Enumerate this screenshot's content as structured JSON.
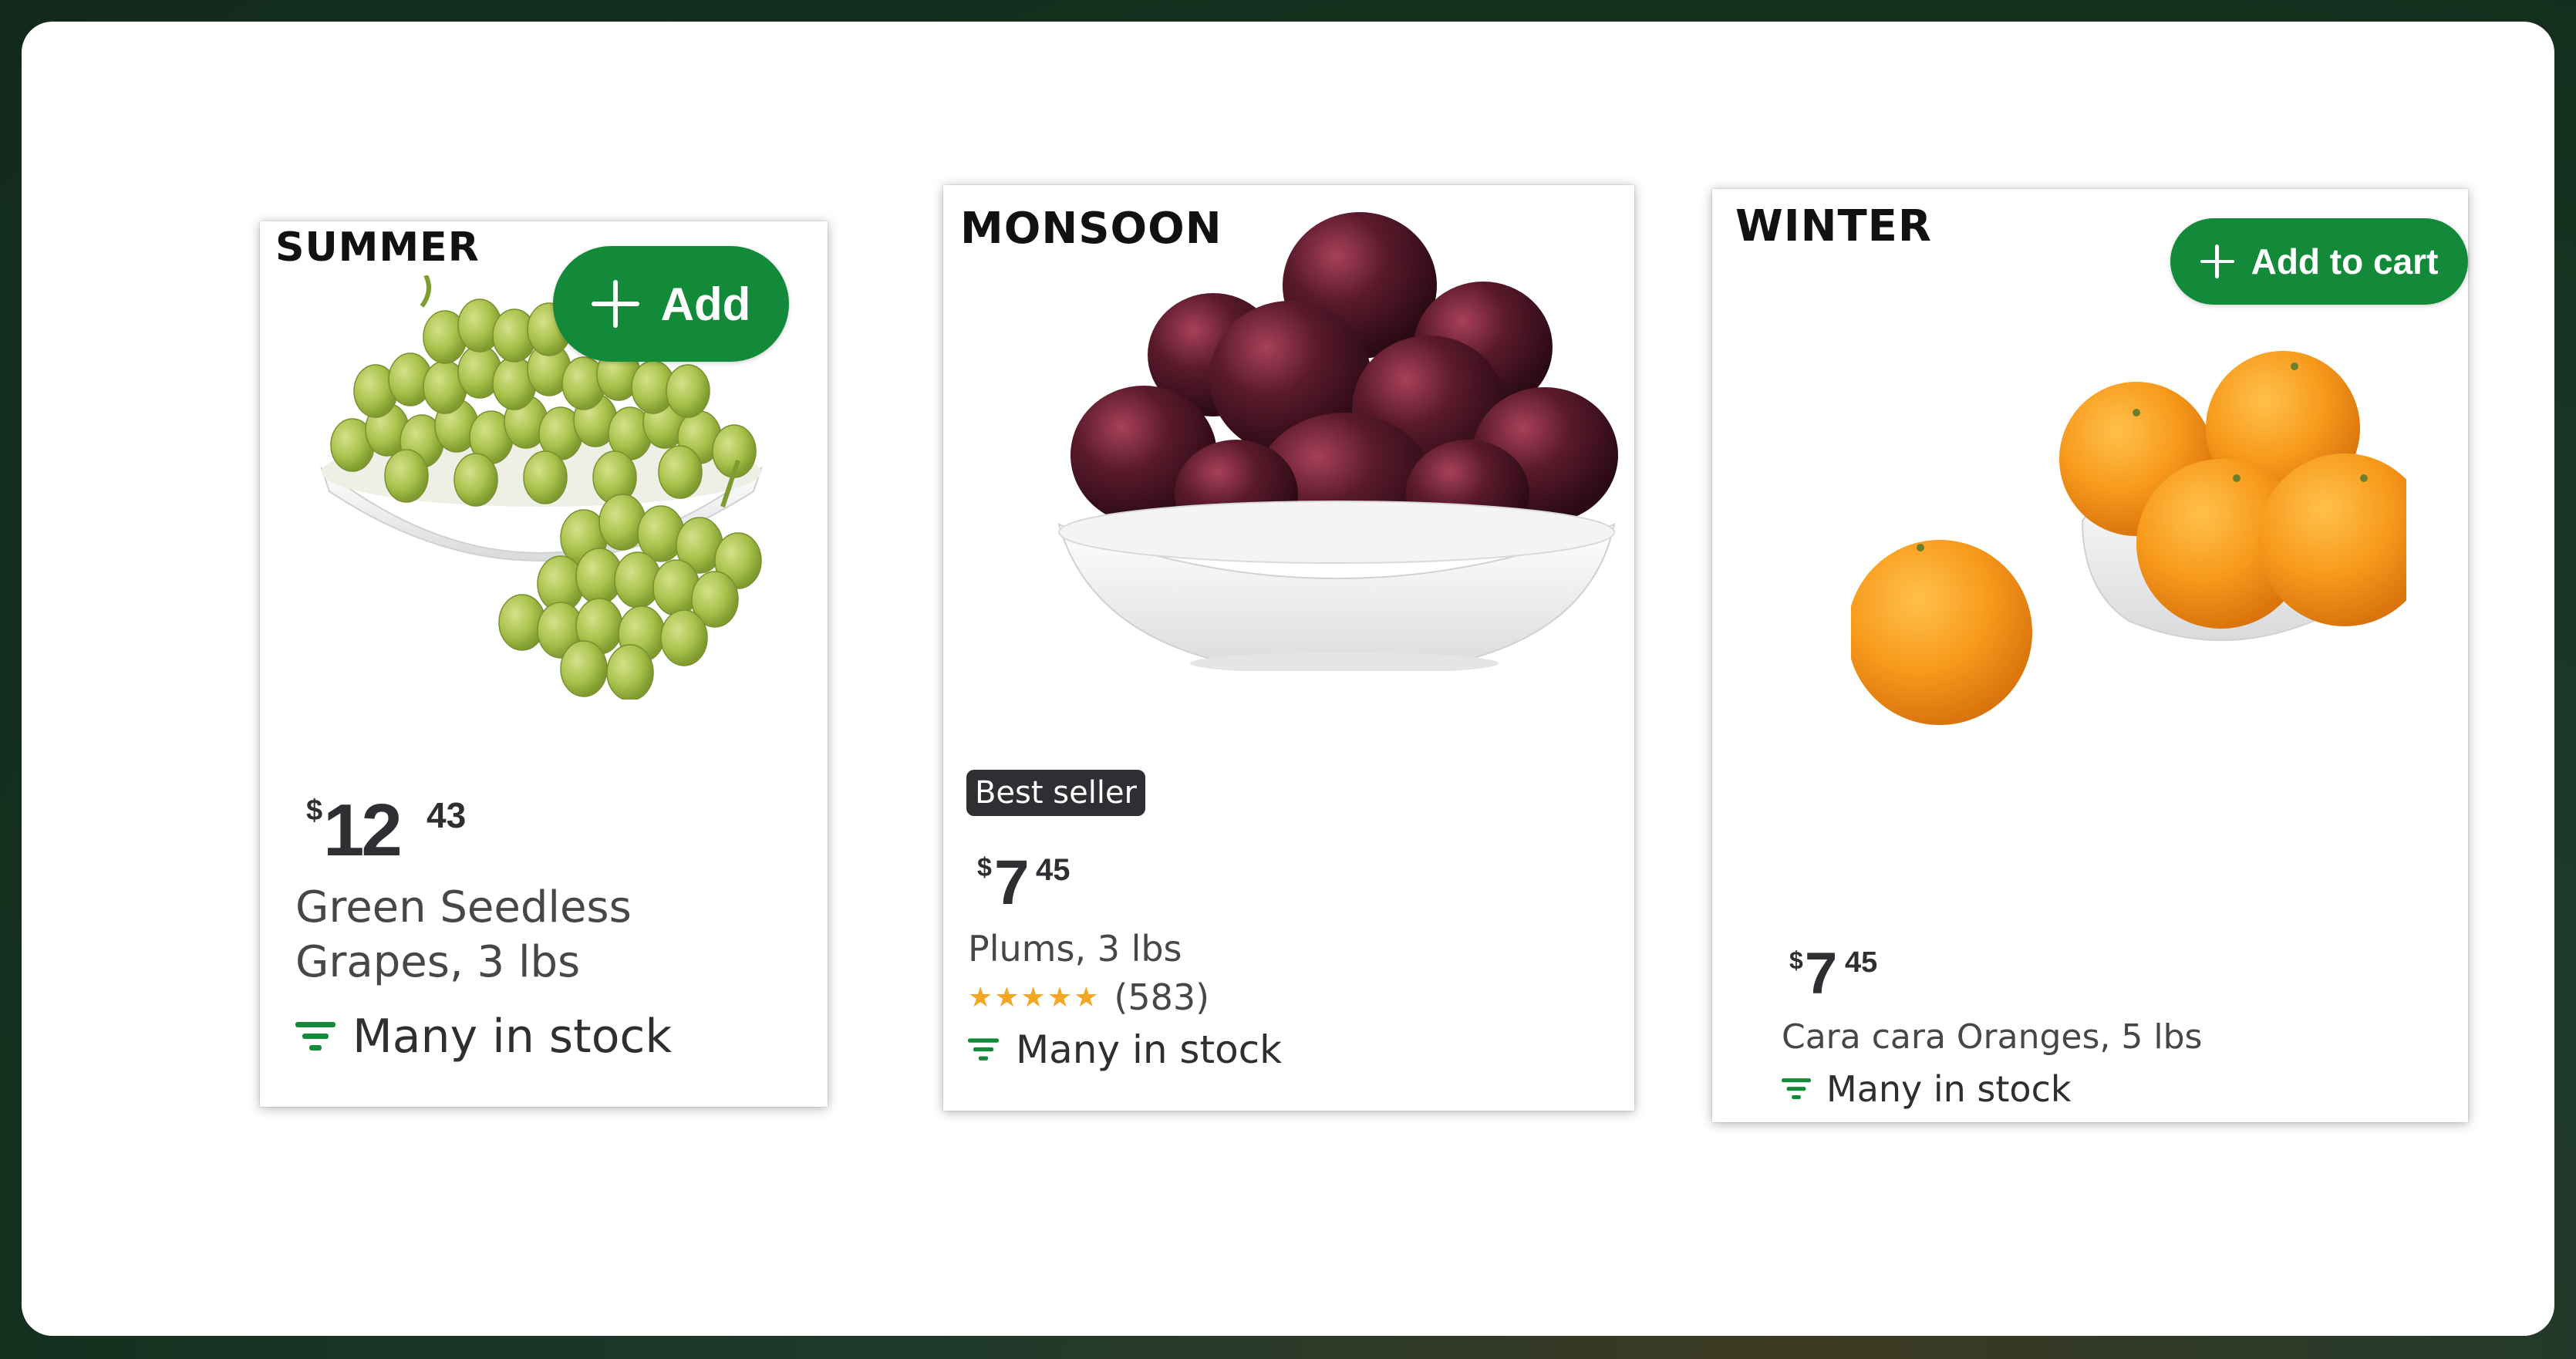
{
  "cards": [
    {
      "season": "SUMMER",
      "button_label": "Add",
      "price": {
        "currency": "$",
        "dollars": "12",
        "cents": "43"
      },
      "name": "Green Seedless Grapes, 3 lbs",
      "stock": "Many in stock",
      "image": "green-grapes-bowl"
    },
    {
      "season": "MONSOON",
      "badge": "Best seller",
      "price": {
        "currency": "$",
        "dollars": "7",
        "cents": "45"
      },
      "name": "Plums, 3 lbs",
      "rating": {
        "stars": "★★★★★",
        "count": "(583)",
        "value": 5
      },
      "stock": "Many in stock",
      "image": "plums-bowl"
    },
    {
      "season": "WINTER",
      "button_label": "Add to cart",
      "price": {
        "currency": "$",
        "dollars": "7",
        "cents": "45"
      },
      "name": "Cara cara Oranges, 5 lbs",
      "stock": "Many in stock",
      "image": "oranges-bowl"
    }
  ],
  "colors": {
    "accent_green": "#138a3a",
    "badge_bg": "#2e2f32",
    "star": "#f5a623",
    "frame_dark": "#14301f"
  },
  "icons": {
    "stock": "stock-level-icon",
    "plus": "plus-icon",
    "star": "star-icon"
  }
}
